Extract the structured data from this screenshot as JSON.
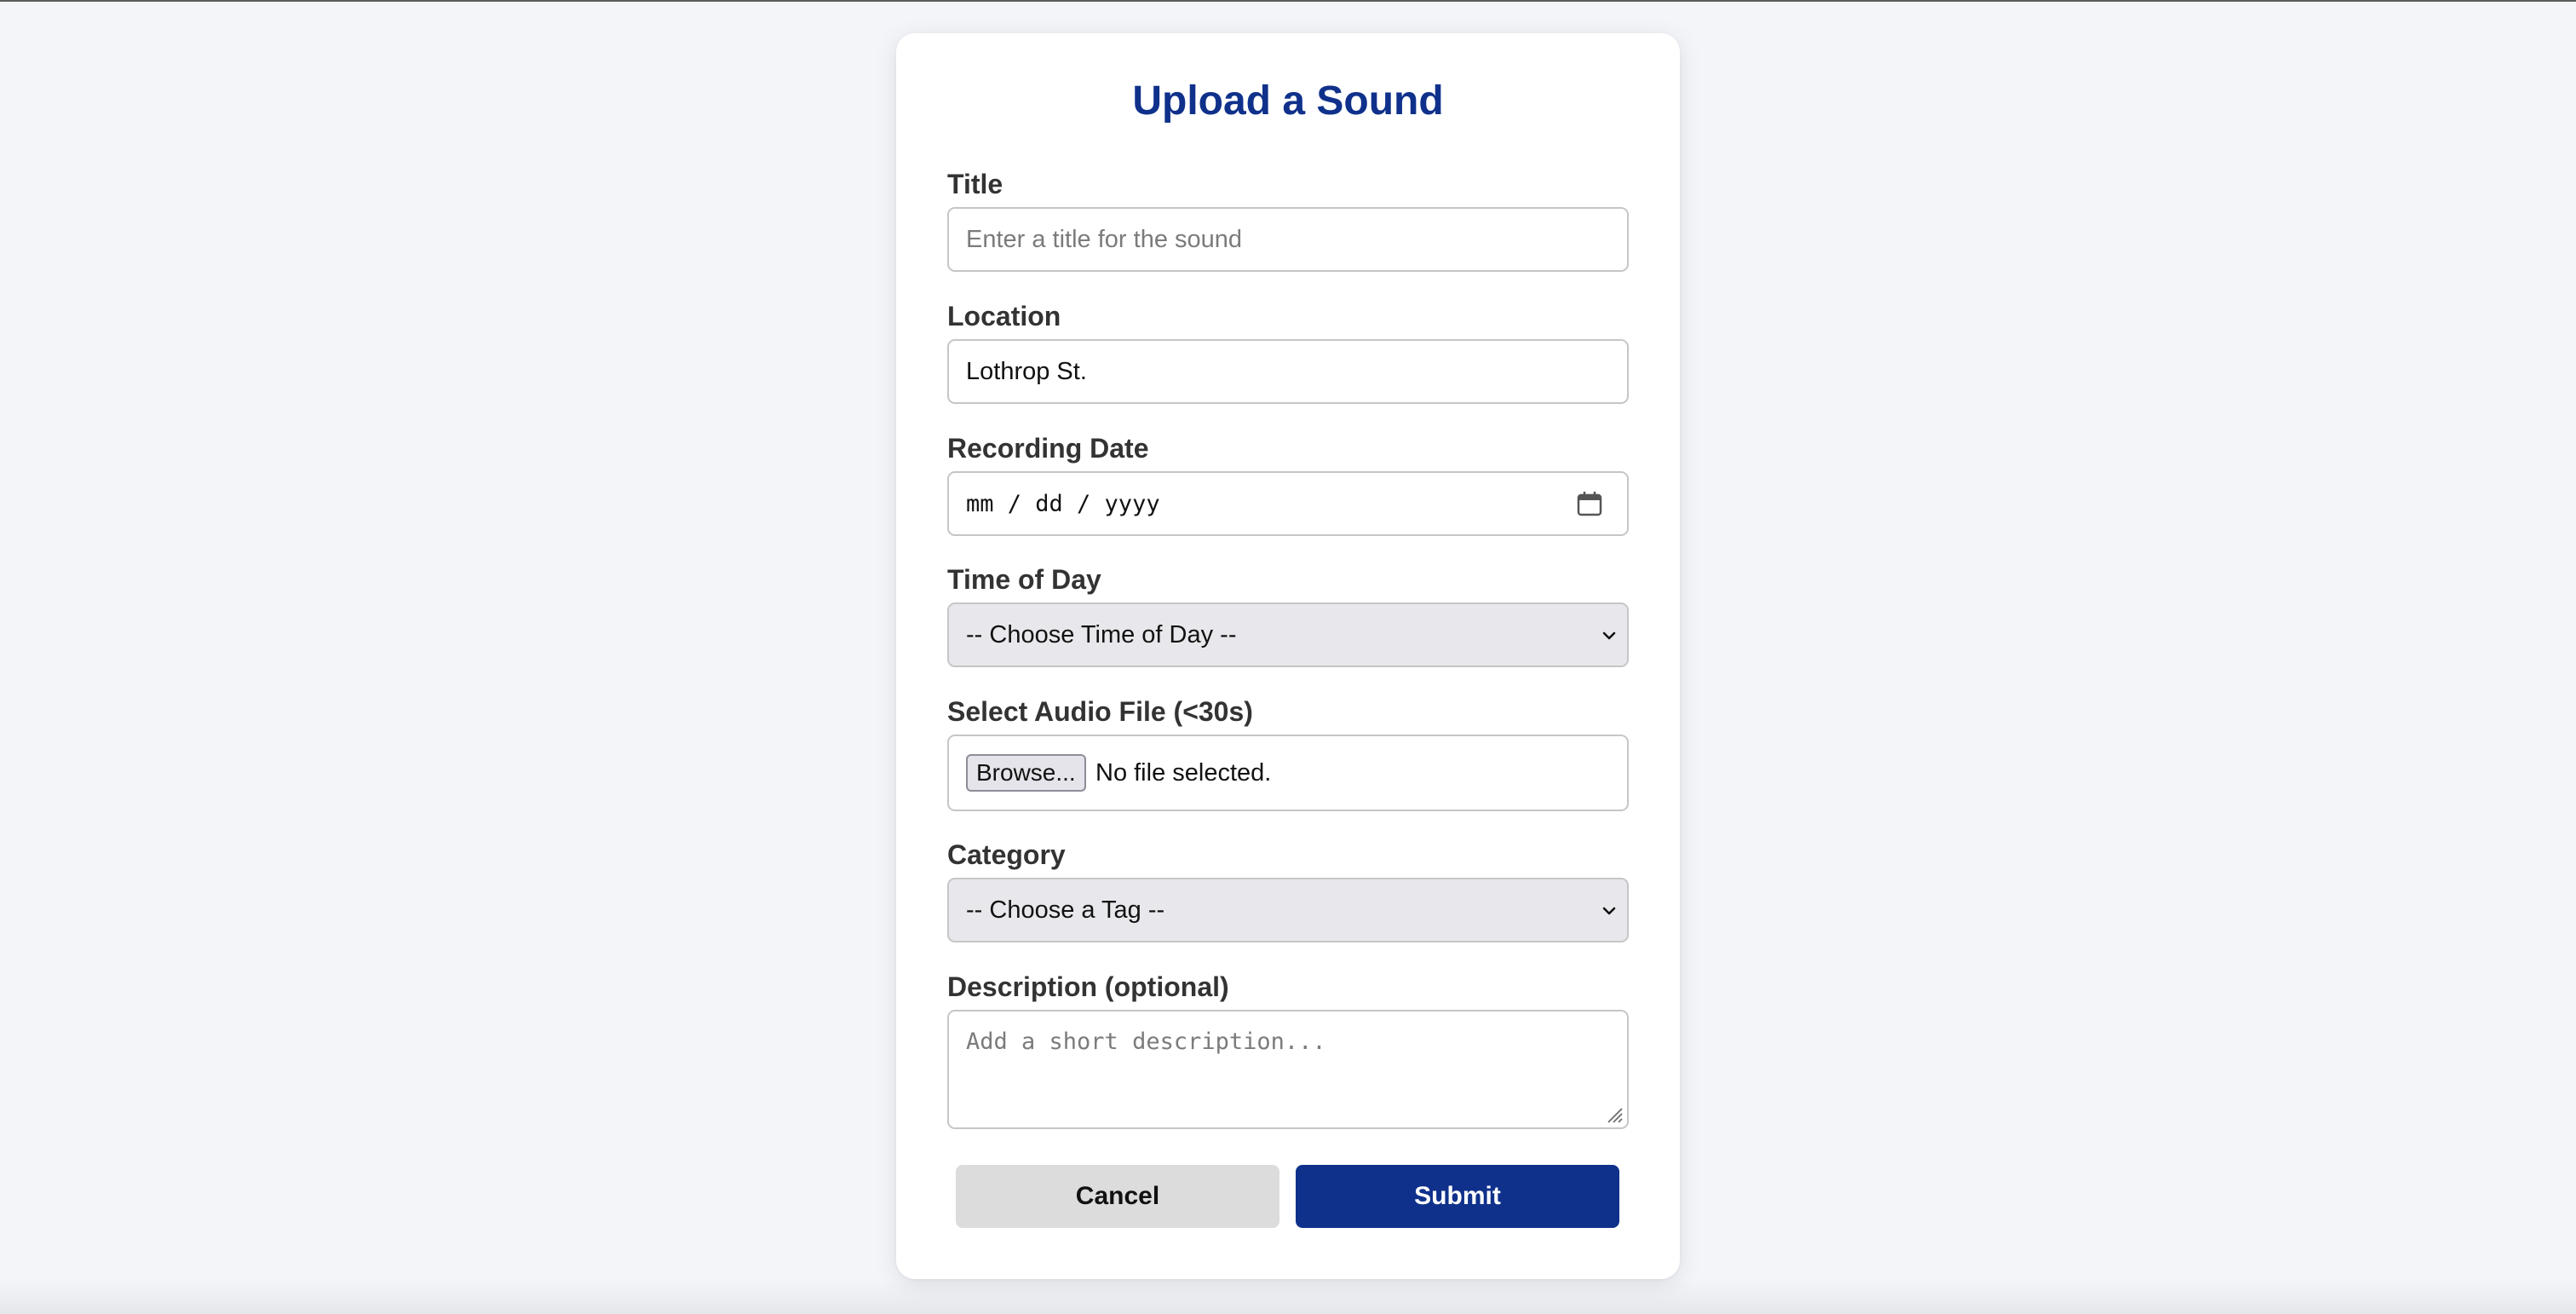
{
  "form": {
    "heading": "Upload a Sound",
    "title": {
      "label": "Title",
      "placeholder": "Enter a title for the sound",
      "value": ""
    },
    "location": {
      "label": "Location",
      "value": "Lothrop St."
    },
    "recording_date": {
      "label": "Recording Date",
      "value_format": "mm / dd / yyyy"
    },
    "time_of_day": {
      "label": "Time of Day",
      "selected": "-- Choose Time of Day --"
    },
    "audio_file": {
      "label": "Select Audio File (<30s)",
      "browse_label": "Browse...",
      "status": "No file selected."
    },
    "category": {
      "label": "Category",
      "selected": "-- Choose a Tag --"
    },
    "description": {
      "label": "Description (optional)",
      "placeholder": "Add a short description..."
    },
    "buttons": {
      "cancel": "Cancel",
      "submit": "Submit"
    }
  },
  "colors": {
    "accent": "#0f318b",
    "page_background": "#f4f5f9",
    "card_background": "#ffffff",
    "select_background": "#e8e8ec",
    "cancel_background": "#dcdcdc"
  },
  "icons": {
    "date_picker": "calendar-icon",
    "select_arrow": "chevron-down-icon",
    "textarea_resize": "resize-grip-icon"
  }
}
